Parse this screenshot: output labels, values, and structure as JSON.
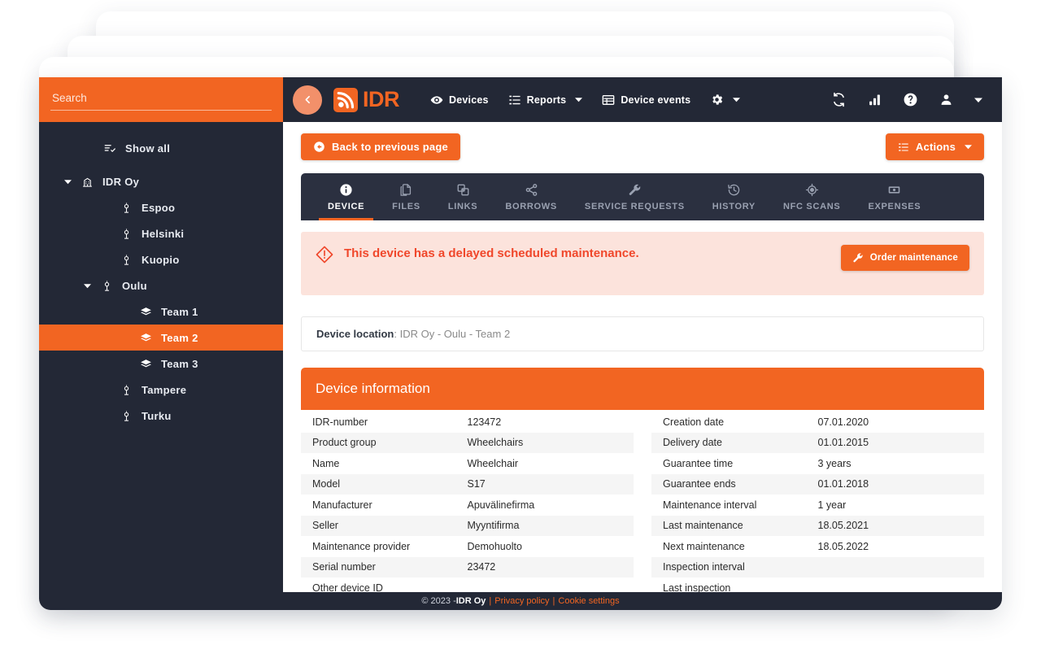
{
  "sidebar": {
    "search": {
      "placeholder": "Search",
      "value": ""
    },
    "items": [
      {
        "label": "Show all",
        "icon": "list-check-icon",
        "indent": 0,
        "caret": "none",
        "selected": false
      },
      {
        "label": "IDR Oy",
        "icon": "building-icon",
        "indent": 1,
        "caret": "down",
        "selected": false
      },
      {
        "label": "Espoo",
        "icon": "location-pin-icon",
        "indent": 2,
        "caret": "none",
        "selected": false
      },
      {
        "label": "Helsinki",
        "icon": "location-pin-icon",
        "indent": 2,
        "caret": "none",
        "selected": false
      },
      {
        "label": "Kuopio",
        "icon": "location-pin-icon",
        "indent": 2,
        "caret": "none",
        "selected": false
      },
      {
        "label": "Oulu",
        "icon": "location-pin-icon",
        "indent": 3,
        "caret": "down",
        "selected": false
      },
      {
        "label": "Team 1",
        "icon": "layers-icon",
        "indent": 4,
        "caret": "none",
        "selected": false
      },
      {
        "label": "Team 2",
        "icon": "layers-icon",
        "indent": 4,
        "caret": "none",
        "selected": true
      },
      {
        "label": "Team 3",
        "icon": "layers-icon",
        "indent": 4,
        "caret": "none",
        "selected": false
      },
      {
        "label": "Tampere",
        "icon": "location-pin-icon",
        "indent": 2,
        "caret": "none",
        "selected": false
      },
      {
        "label": "Turku",
        "icon": "location-pin-icon",
        "indent": 2,
        "caret": "none",
        "selected": false
      }
    ]
  },
  "navbar": {
    "brand": "IDR",
    "back_icon": "chevron-left-icon",
    "items": [
      {
        "label": "Devices",
        "icon": "eye-icon",
        "caret": false
      },
      {
        "label": "Reports",
        "icon": "list-icon",
        "caret": true
      },
      {
        "label": "Device events",
        "icon": "table-icon",
        "caret": false
      },
      {
        "label": "",
        "icon": "gear-icon",
        "caret": true
      }
    ],
    "right_icons": [
      "sync-icon",
      "bar-chart-icon",
      "help-icon",
      "user-icon",
      "chevron-down-icon"
    ]
  },
  "toolbar": {
    "back_label": "Back to previous page",
    "back_icon": "arrow-left-circle-icon",
    "actions_label": "Actions",
    "actions_icon": "list-icon",
    "actions_caret": "chevron-down-icon"
  },
  "tabs": [
    {
      "label": "DEVICE",
      "icon": "info-icon",
      "active": true
    },
    {
      "label": "FILES",
      "icon": "files-icon",
      "active": false
    },
    {
      "label": "LINKS",
      "icon": "link-copy-icon",
      "active": false
    },
    {
      "label": "BORROWS",
      "icon": "share-icon",
      "active": false
    },
    {
      "label": "SERVICE REQUESTS",
      "icon": "wrench-icon",
      "active": false
    },
    {
      "label": "HISTORY",
      "icon": "history-icon",
      "active": false
    },
    {
      "label": "NFC SCANS",
      "icon": "target-icon",
      "active": false
    },
    {
      "label": "EXPENSES",
      "icon": "money-icon",
      "active": false
    }
  ],
  "alert": {
    "icon": "warning-diamond-icon",
    "message": "This device has a delayed scheduled maintenance.",
    "button_label": "Order maintenance",
    "button_icon": "wrench-icon"
  },
  "location": {
    "label": "Device location",
    "separator": ": ",
    "value": "IDR Oy - Oulu - Team 2"
  },
  "info": {
    "title": "Device information",
    "left": [
      {
        "key": "IDR-number",
        "value": "123472"
      },
      {
        "key": "Product group",
        "value": "Wheelchairs"
      },
      {
        "key": "Name",
        "value": "Wheelchair"
      },
      {
        "key": "Model",
        "value": "S17"
      },
      {
        "key": "Manufacturer",
        "value": "Apuvälinefirma"
      },
      {
        "key": "Seller",
        "value": "Myyntifirma"
      },
      {
        "key": "Maintenance provider",
        "value": "Demohuolto"
      },
      {
        "key": "Serial number",
        "value": "23472"
      },
      {
        "key": "Other device ID",
        "value": ""
      }
    ],
    "right": [
      {
        "key": "Creation date",
        "value": "07.01.2020"
      },
      {
        "key": "Delivery date",
        "value": "01.01.2015"
      },
      {
        "key": "Guarantee time",
        "value": "3 years"
      },
      {
        "key": "Guarantee ends",
        "value": "01.01.2018"
      },
      {
        "key": "Maintenance interval",
        "value": "1 year"
      },
      {
        "key": "Last maintenance",
        "value": "18.05.2021"
      },
      {
        "key": "Next maintenance",
        "value": "18.05.2022"
      },
      {
        "key": "Inspection interval",
        "value": ""
      },
      {
        "key": "Last inspection",
        "value": ""
      }
    ]
  },
  "footer": {
    "copyright": "© 2023 - ",
    "company": "IDR Oy",
    "sep": "|",
    "privacy": "Privacy policy",
    "cookies": "Cookie settings"
  },
  "colors": {
    "accent": "#F26522",
    "dark": "#232836",
    "tabbar": "#2B3040",
    "alert_bg": "#FCE3DC",
    "alert_text": "#F0472B",
    "row_alt": "#F5F5F5"
  }
}
